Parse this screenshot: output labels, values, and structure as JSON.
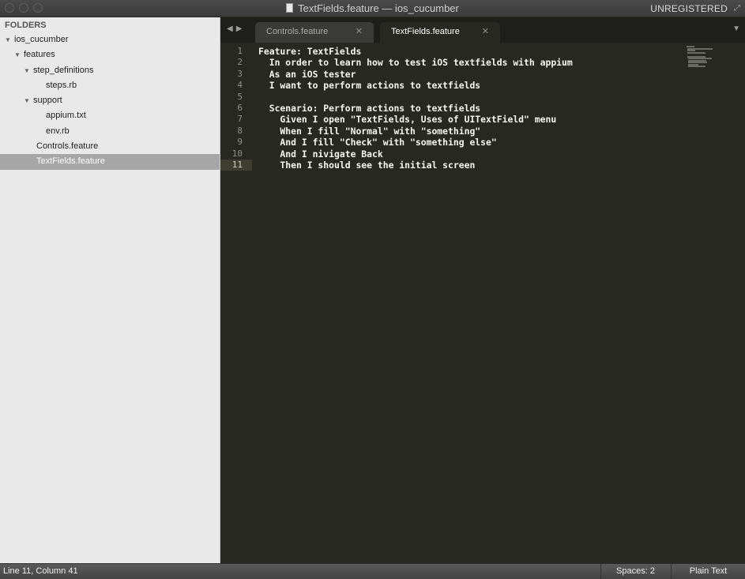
{
  "window": {
    "title": "TextFields.feature — ios_cucumber",
    "unregistered": "UNREGISTERED"
  },
  "sidebar": {
    "header": "FOLDERS",
    "items": [
      {
        "label": "ios_cucumber",
        "expanded": true
      },
      {
        "label": "features",
        "expanded": true
      },
      {
        "label": "step_definitions",
        "expanded": true
      },
      {
        "label": "steps.rb"
      },
      {
        "label": "support",
        "expanded": true
      },
      {
        "label": "appium.txt"
      },
      {
        "label": "env.rb"
      },
      {
        "label": "Controls.feature"
      },
      {
        "label": "TextFields.feature",
        "selected": true
      }
    ]
  },
  "tabs": [
    {
      "label": "Controls.feature",
      "active": false
    },
    {
      "label": "TextFields.feature",
      "active": true
    }
  ],
  "editor": {
    "current_line": 11,
    "lines": [
      "Feature: TextFields",
      "  In order to learn how to test iOS textfields with appium",
      "  As an iOS tester",
      "  I want to perform actions to textfields",
      "",
      "  Scenario: Perform actions to textfields",
      "    Given I open \"TextFields, Uses of UITextField\" menu",
      "    When I fill \"Normal\" with \"something\"",
      "    And I fill \"Check\" with \"something else\"",
      "    And I nivigate Back",
      "    Then I should see the initial screen"
    ]
  },
  "status": {
    "position": "Line 11, Column 41",
    "spaces": "Spaces: 2",
    "syntax": "Plain Text"
  },
  "colors": {
    "editor_bg": "#272822",
    "sidebar_bg": "#e9e9e9",
    "selected_item_bg": "#a6a6a6",
    "code_text": "#f8f8f2"
  }
}
